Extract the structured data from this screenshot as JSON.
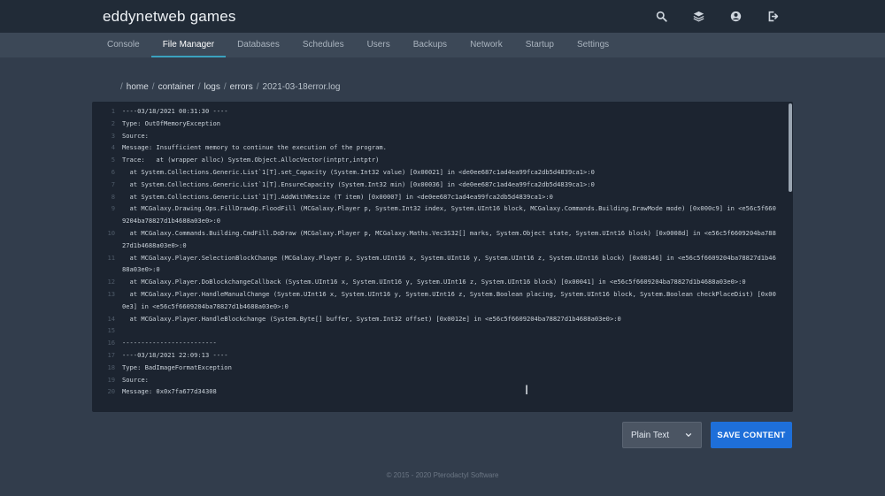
{
  "app": {
    "title": "eddynetweb games"
  },
  "topbar": {
    "icons": [
      "search-icon",
      "layers-icon",
      "account-icon",
      "logout-icon"
    ]
  },
  "nav": {
    "tabs": [
      {
        "label": "Console",
        "active": false
      },
      {
        "label": "File Manager",
        "active": true
      },
      {
        "label": "Databases",
        "active": false
      },
      {
        "label": "Schedules",
        "active": false
      },
      {
        "label": "Users",
        "active": false
      },
      {
        "label": "Backups",
        "active": false
      },
      {
        "label": "Network",
        "active": false
      },
      {
        "label": "Startup",
        "active": false
      },
      {
        "label": "Settings",
        "active": false
      }
    ]
  },
  "breadcrumb": {
    "sep": "/",
    "segments": [
      "home",
      "container",
      "logs",
      "errors"
    ],
    "file": "2021-03-18error.log"
  },
  "editor": {
    "lines": [
      {
        "n": "1",
        "t": "----03/18/2021 00:31:30 ----"
      },
      {
        "n": "2",
        "t": "Type: OutOfMemoryException"
      },
      {
        "n": "3",
        "t": "Source:"
      },
      {
        "n": "4",
        "t": "Message: Insufficient memory to continue the execution of the program."
      },
      {
        "n": "5",
        "t": "Trace:   at (wrapper alloc) System.Object.AllocVector(intptr,intptr)"
      },
      {
        "n": "6",
        "t": "  at System.Collections.Generic.List`1[T].set_Capacity (System.Int32 value) [0x00021] in <de0ee687c1ad4ea99fca2db5d4839ca1>:0"
      },
      {
        "n": "7",
        "t": "  at System.Collections.Generic.List`1[T].EnsureCapacity (System.Int32 min) [0x00036] in <de0ee687c1ad4ea99fca2db5d4839ca1>:0"
      },
      {
        "n": "8",
        "t": "  at System.Collections.Generic.List`1[T].AddWithResize (T item) [0x00007] in <de0ee687c1ad4ea99fca2db5d4839ca1>:0"
      },
      {
        "n": "9",
        "t": "  at MCGalaxy.Drawing.Ops.FillDrawOp.FloodFill (MCGalaxy.Player p, System.Int32 index, System.UInt16 block, MCGalaxy.Commands.Building.DrawMode mode) [0x000c9] in <e56c5f6609204ba78827d1b4688a03e0>:0"
      },
      {
        "n": "10",
        "t": "  at MCGalaxy.Commands.Building.CmdFill.DoDraw (MCGalaxy.Player p, MCGalaxy.Maths.Vec3S32[] marks, System.Object state, System.UInt16 block) [0x0008d] in <e56c5f6609204ba78827d1b4688a03e0>:0"
      },
      {
        "n": "11",
        "t": "  at MCGalaxy.Player.SelectionBlockChange (MCGalaxy.Player p, System.UInt16 x, System.UInt16 y, System.UInt16 z, System.UInt16 block) [0x00146] in <e56c5f6609204ba78827d1b4688a03e0>:0"
      },
      {
        "n": "12",
        "t": "  at MCGalaxy.Player.DoBlockchangeCallback (System.UInt16 x, System.UInt16 y, System.UInt16 z, System.UInt16 block) [0x00041] in <e56c5f6609204ba78827d1b4688a03e0>:0"
      },
      {
        "n": "13",
        "t": "  at MCGalaxy.Player.HandleManualChange (System.UInt16 x, System.UInt16 y, System.UInt16 z, System.Boolean placing, System.UInt16 block, System.Boolean checkPlaceDist) [0x000e3] in <e56c5f6609204ba78827d1b4688a03e0>:0"
      },
      {
        "n": "14",
        "t": "  at MCGalaxy.Player.HandleBlockchange (System.Byte[] buffer, System.Int32 offset) [0x0012e] in <e56c5f6609204ba78827d1b4688a03e0>:0"
      },
      {
        "n": "15",
        "t": ""
      },
      {
        "n": "16",
        "t": "-------------------------"
      },
      {
        "n": "17",
        "t": "----03/18/2021 22:09:13 ----"
      },
      {
        "n": "18",
        "t": "Type: BadImageFormatException"
      },
      {
        "n": "19",
        "t": "Source:"
      },
      {
        "n": "20",
        "t": "Message: 0x0x7fa677d34308"
      }
    ]
  },
  "controls": {
    "mode_label": "Plain Text",
    "save_label": "SAVE CONTENT"
  },
  "footer": {
    "text": "© 2015 - 2020 Pterodactyl Software"
  }
}
